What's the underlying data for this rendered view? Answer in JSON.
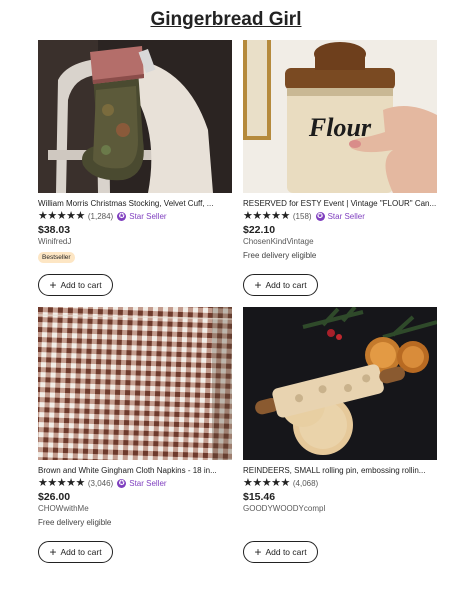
{
  "page": {
    "title": "Gingerbread Girl"
  },
  "ui": {
    "add_to_cart": "Add to cart",
    "plus_icon": "+",
    "star_glyph": "★",
    "seller_badge_glyph": "✪"
  },
  "colors": {
    "star_seller": "#7f3fbf",
    "bestseller_bg": "#fde6c4"
  },
  "products": [
    {
      "title": "William Morris Christmas Stocking, Velvet Cuff, ...",
      "rating": 5,
      "reviews": "(1,284)",
      "star_seller": "Star Seller",
      "price": "$38.03",
      "shop": "WinifredJ",
      "badge": "Bestseller",
      "delivery": ""
    },
    {
      "title": "RESERVED for ESTY Event | Vintage \"FLOUR\" Can...",
      "rating": 5,
      "reviews": "(158)",
      "star_seller": "Star Seller",
      "price": "$22.10",
      "shop": "ChosenKindVintage",
      "badge": "",
      "delivery": "Free delivery eligible",
      "image_text": "Flour"
    },
    {
      "title": "Brown and White Gingham Cloth Napkins - 18 in...",
      "rating": 5,
      "reviews": "(3,046)",
      "star_seller": "Star Seller",
      "price": "$26.00",
      "shop": "CHOWwithMe",
      "badge": "",
      "delivery": "Free delivery eligible"
    },
    {
      "title": "REINDEERS, SMALL rolling pin, embossing rollin...",
      "rating": 5,
      "reviews": "(4,068)",
      "star_seller": "",
      "price": "$15.46",
      "shop": "GOODYWOODYcompl",
      "badge": "",
      "delivery": ""
    }
  ]
}
